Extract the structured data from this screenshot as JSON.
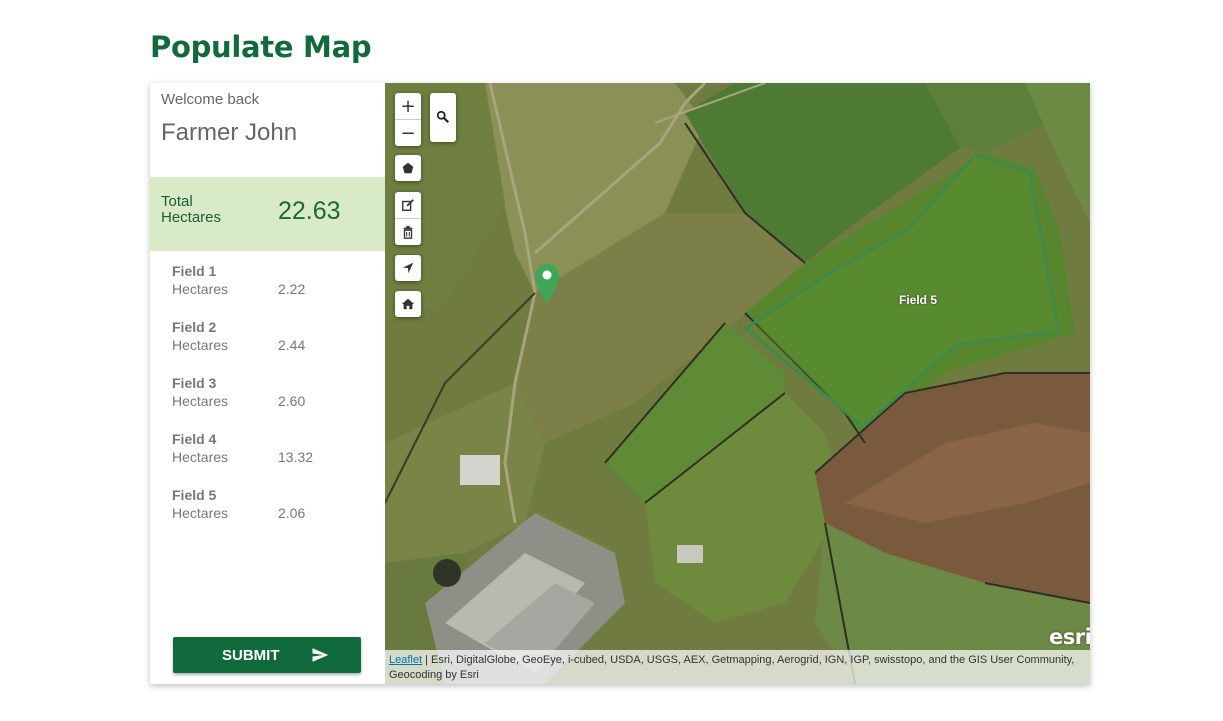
{
  "page": {
    "title": "Populate Map"
  },
  "sidebar": {
    "welcome": "Welcome back",
    "user_name": "Farmer John",
    "total": {
      "label": "Total Hectares",
      "value": "22.63"
    },
    "fields": [
      {
        "name": "Field 1",
        "unit": "Hectares",
        "value": "2.22"
      },
      {
        "name": "Field 2",
        "unit": "Hectares",
        "value": "2.44"
      },
      {
        "name": "Field 3",
        "unit": "Hectares",
        "value": "2.60"
      },
      {
        "name": "Field 4",
        "unit": "Hectares",
        "value": "13.32"
      },
      {
        "name": "Field 5",
        "unit": "Hectares",
        "value": "2.06"
      }
    ],
    "submit_label": "SUBMIT"
  },
  "map": {
    "controls": {
      "zoom_in": "+",
      "zoom_out": "−",
      "search_icon": "search-icon",
      "polygon_icon": "pentagon-icon",
      "edit_icon": "edit-icon",
      "delete_icon": "trash-icon",
      "locate_icon": "navigation-arrow-icon",
      "home_icon": "home-icon"
    },
    "polygon_label": "Field 5",
    "marker_icon": "map-pin-icon",
    "logo": "esri",
    "attribution_link": "Leaflet",
    "attribution_text": " | Esri, DigitalGlobe, GeoEye, i-cubed, USDA, USGS, AEX, Getmapping, Aerogrid, IGN, IGP, swisstopo, and the GIS User Community, Geocoding by Esri"
  },
  "colors": {
    "brand_green": "#106a3b",
    "total_bg": "#d8eac6",
    "polygon_stroke": "#3f8a4a",
    "marker": "#3fa657"
  }
}
